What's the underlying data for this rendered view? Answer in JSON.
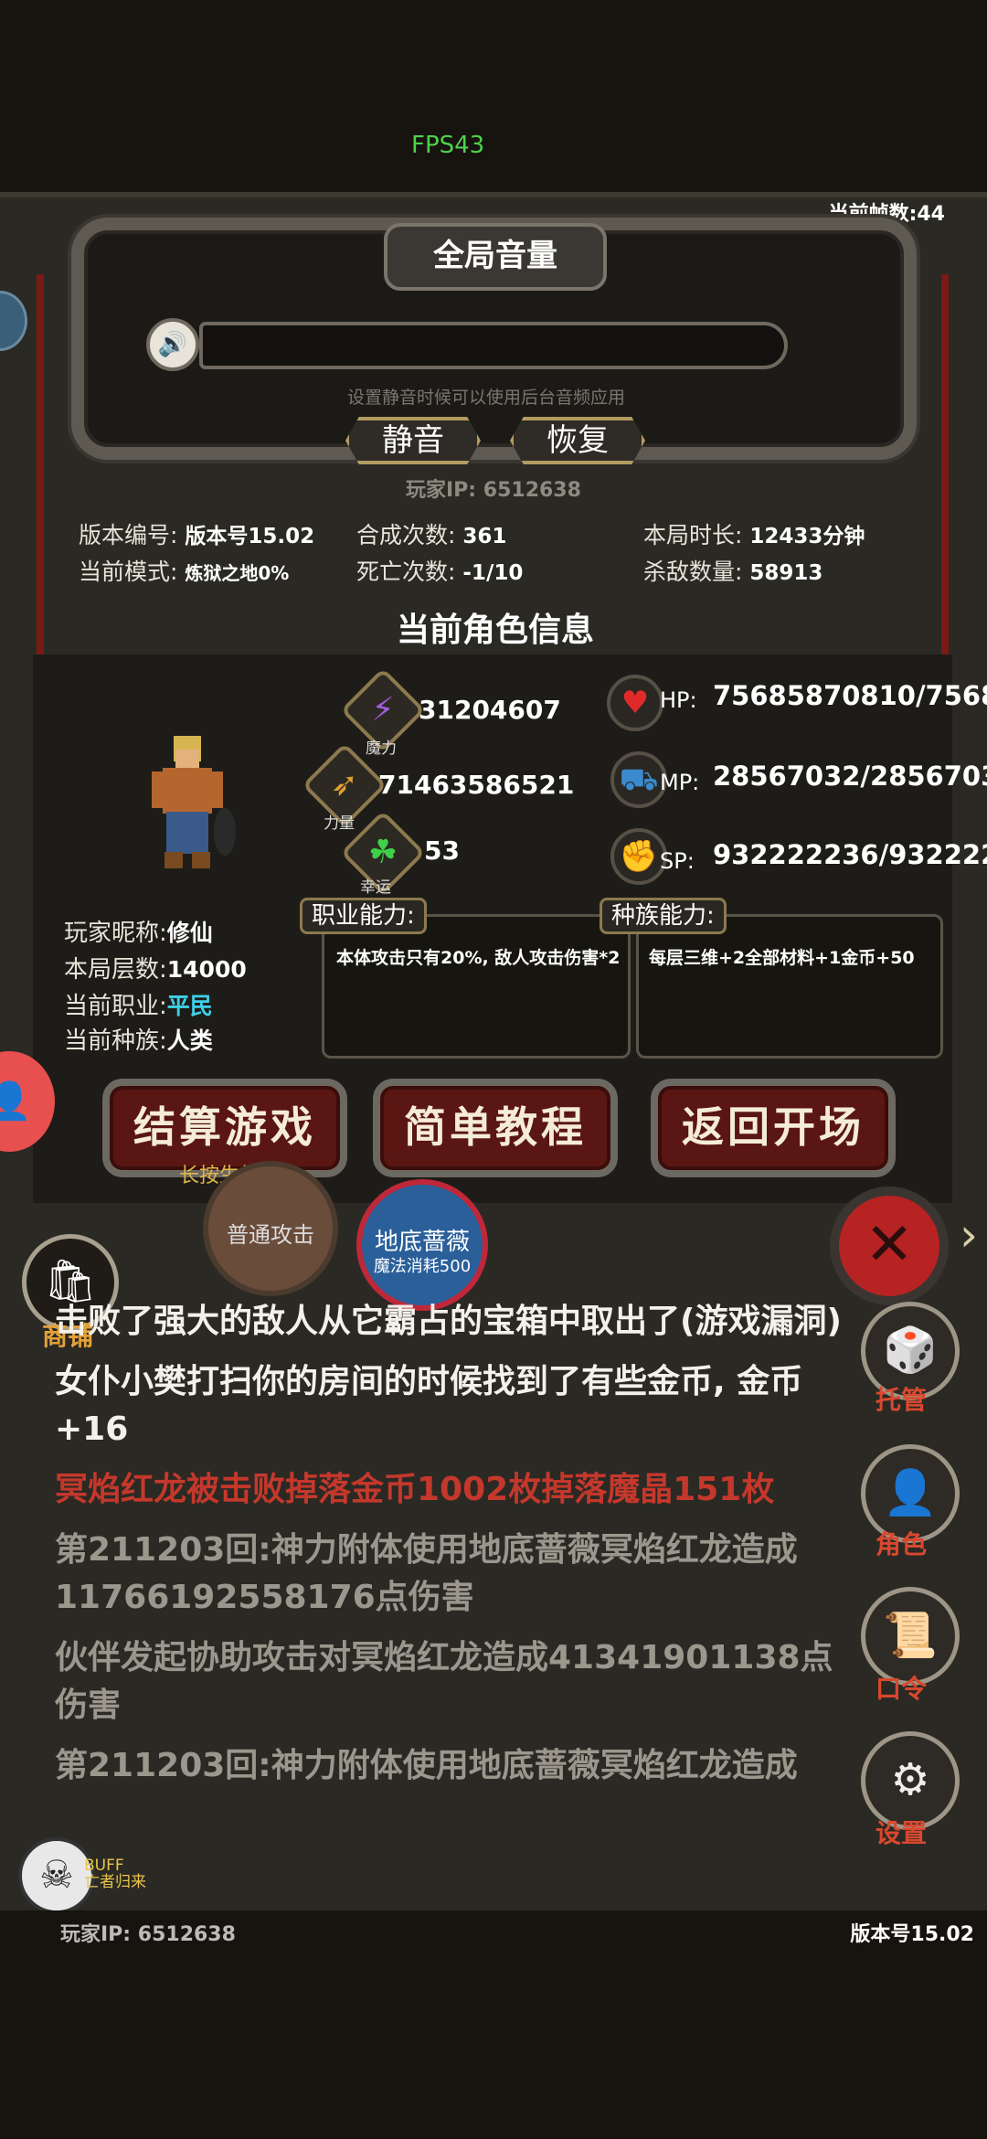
{
  "overlay": {
    "fps": "FPS43",
    "frame_rate": "当前帧数:44"
  },
  "volume": {
    "title": "全局音量",
    "hint": "设置静音时候可以使用后台音频应用",
    "mute_label": "静音",
    "restore_label": "恢复",
    "level": 0
  },
  "player_ip": "玩家IP:  6512638",
  "stats": {
    "version_label": "版本编号:",
    "version_value": "版本号15.02",
    "mode_label": "当前模式:",
    "mode_value": "炼狱之地0%",
    "craft_label": "合成次数:",
    "craft_value": "361",
    "death_label": "死亡次数:",
    "death_value": "-1/10",
    "duration_label": "本局时长:",
    "duration_value": "12433分钟",
    "kills_label": "杀敌数量:",
    "kills_value": "58913"
  },
  "character": {
    "section_title": "当前角色信息",
    "magic_caption": "魔力",
    "magic_value": "31204607",
    "strength_caption": "力量",
    "strength_value": "71463586521",
    "luck_caption": "幸运",
    "luck_value": "53",
    "hp_label": "HP:",
    "hp_value": "75685870810/7568",
    "mp_label": "MP:",
    "mp_value": "28567032/2856703",
    "sp_label": "SP:",
    "sp_value": "932222236/932222",
    "nickname_label": "玩家昵称:",
    "nickname_value": "修仙",
    "floor_label": "本局层数:",
    "floor_value": "14000",
    "job_label": "当前职业:",
    "job_value": "平民",
    "race_label": "当前种族:",
    "race_value": "人类",
    "job_ability_tag": "职业能力:",
    "job_ability_text": "本体攻击只有20%, 敌人攻击伤害*2",
    "race_ability_tag": "种族能力:",
    "race_ability_text": "每层三维+2全部材料+1金币+50"
  },
  "buttons": {
    "settle": "结算游戏",
    "settle_hint": "长按生效",
    "tutorial": "简单教程",
    "return": "返回开场"
  },
  "skills": {
    "normal_attack": "普通攻击",
    "rose": "地底蔷薇",
    "rose_cost": "魔法消耗500"
  },
  "side_menu": {
    "shop": "商铺",
    "auto": "托管",
    "role": "角色",
    "code": "口令",
    "settings": "设置"
  },
  "log": [
    {
      "text": "击败了强大的敌人从它霸占的宝箱中取出了(游戏漏洞)",
      "color": "white"
    },
    {
      "text": "女仆小樊打扫你的房间的时候找到了有些金币, 金币+16",
      "color": "white"
    },
    {
      "text": "冥焰红龙被击败掉落金币1002枚掉落魔晶151枚",
      "color": "red"
    },
    {
      "text": "第211203回:神力附体使用地底蔷薇冥焰红龙造成11766192558176点伤害",
      "color": "grey"
    },
    {
      "text": "伙伴发起协助攻击对冥焰红龙造成41341901138点伤害",
      "color": "grey"
    },
    {
      "text": "第211203回:神力附体使用地底蔷薇冥焰红龙造成",
      "color": "grey"
    }
  ],
  "buff": {
    "tag1": "BUFF",
    "tag2": "亡者归来"
  },
  "footer": {
    "ip": "玩家IP:  6512638",
    "version": "版本号15.02"
  },
  "colors": {
    "accent_gold": "#b29b61",
    "danger_red": "#c4382c",
    "job_cyan": "#3fd0e8"
  }
}
